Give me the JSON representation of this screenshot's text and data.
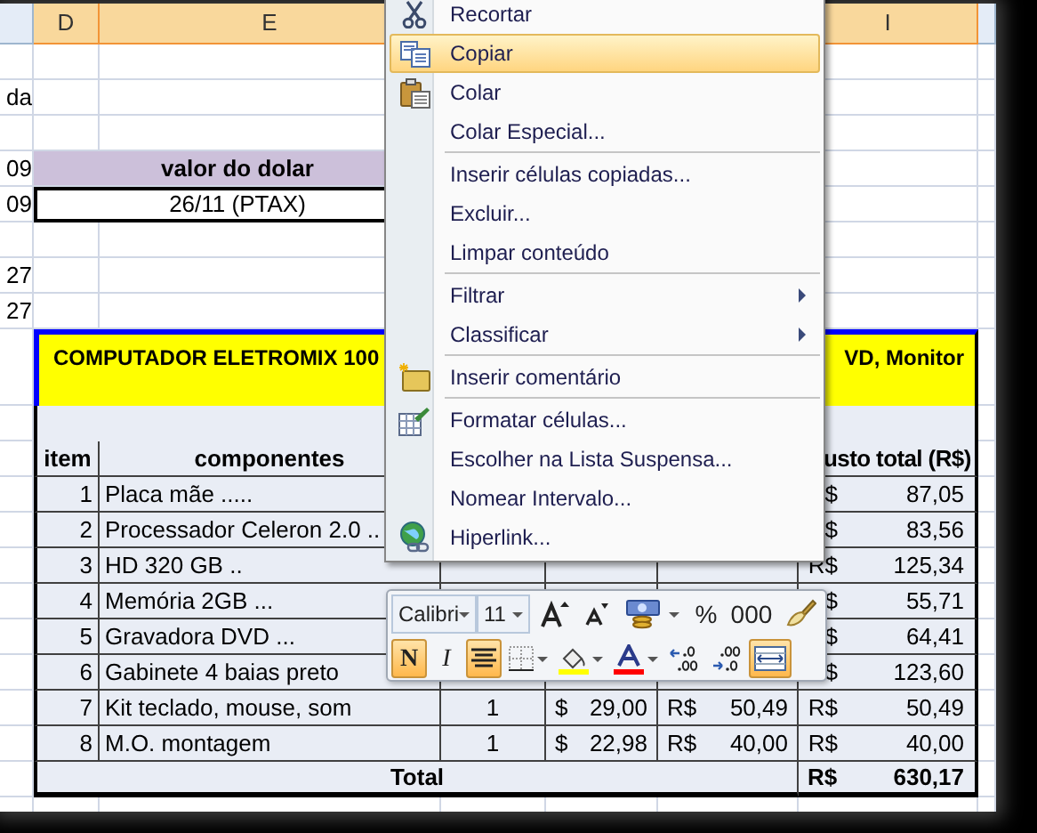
{
  "column_headers": [
    "D",
    "E",
    "I"
  ],
  "left_column_fragments": [
    "da",
    "09",
    "09",
    "27",
    "27"
  ],
  "dollar_box": {
    "heading": "valor do dolar",
    "value": "26/11 (PTAX)"
  },
  "product_table": {
    "title_parts": [
      "COMPUTADOR ELETROMIX 100",
      "VD, Monitor"
    ],
    "headers": [
      "item",
      "componentes",
      "usto total (R$)"
    ],
    "rows": [
      {
        "item": "1",
        "component": "Placa mãe .....",
        "total_currency": "$",
        "total": "87,05"
      },
      {
        "item": "2",
        "component": "Processador Celeron 2.0 ..",
        "total_currency": "$",
        "total": "83,56"
      },
      {
        "item": "3",
        "component": "HD 320 GB ..",
        "total_currency": "R$",
        "total": "125,34"
      },
      {
        "item": "4",
        "component": "Memória 2GB ...",
        "total_currency": "$",
        "total": "55,71"
      },
      {
        "item": "5",
        "component": "Gravadora DVD ...",
        "total_currency": "$",
        "total": "64,41"
      },
      {
        "item": "6",
        "component": "Gabinete 4 baias preto",
        "total_currency": "$",
        "total": "123,60"
      },
      {
        "item": "7",
        "component": "Kit teclado, mouse, som",
        "quantity": "1",
        "usd_sign": "$",
        "usd": "29,00",
        "brl_sign": "R$",
        "brl": "50,49",
        "total_currency": "R$",
        "total": "50,49"
      },
      {
        "item": "8",
        "component": "M.O. montagem",
        "quantity": "1",
        "usd_sign": "$",
        "usd": "22,98",
        "brl_sign": "R$",
        "brl": "40,00",
        "total_currency": "R$",
        "total": "40,00"
      }
    ],
    "total_label": "Total",
    "grand_total_currency": "R$",
    "grand_total": "630,17"
  },
  "context_menu": {
    "items": [
      {
        "kind": "item",
        "label": "Recortar",
        "selected": false
      },
      {
        "kind": "item",
        "label": "Copiar",
        "selected": true
      },
      {
        "kind": "item",
        "label": "Colar",
        "selected": false
      },
      {
        "kind": "item",
        "label": "Colar Especial...",
        "selected": false
      },
      {
        "kind": "separator"
      },
      {
        "kind": "item",
        "label": "Inserir células copiadas...",
        "selected": false
      },
      {
        "kind": "item",
        "label": "Excluir...",
        "selected": false
      },
      {
        "kind": "item",
        "label": "Limpar conteúdo",
        "selected": false
      },
      {
        "kind": "separator"
      },
      {
        "kind": "item",
        "label": "Filtrar",
        "submenu": true,
        "selected": false
      },
      {
        "kind": "item",
        "label": "Classificar",
        "submenu": true,
        "selected": false
      },
      {
        "kind": "separator"
      },
      {
        "kind": "item",
        "label": "Inserir comentário",
        "selected": false
      },
      {
        "kind": "separator"
      },
      {
        "kind": "item",
        "label": "Formatar células...",
        "selected": false
      },
      {
        "kind": "item",
        "label": "Escolher na Lista Suspensa...",
        "selected": false
      },
      {
        "kind": "item",
        "label": "Nomear Intervalo...",
        "selected": false
      },
      {
        "kind": "item",
        "label": "Hiperlink...",
        "selected": false
      }
    ]
  },
  "mini_toolbar": {
    "font": "Calibri",
    "size": "11",
    "row_1": [
      {
        "kind": "grow-font"
      },
      {
        "kind": "shrink-font"
      },
      {
        "kind": "accounting",
        "dropdown": true
      },
      {
        "kind": "text",
        "label": "%"
      },
      {
        "kind": "text",
        "label": "000"
      },
      {
        "kind": "painter"
      }
    ],
    "row_2": [
      {
        "kind": "bold",
        "label": "N",
        "on": true
      },
      {
        "kind": "italic",
        "label": "I",
        "on": false
      },
      {
        "kind": "center",
        "on": true
      },
      {
        "kind": "borders",
        "dropdown": true
      },
      {
        "kind": "fill",
        "color": "#ffff00",
        "dropdown": true
      },
      {
        "kind": "font-color",
        "color": "#ff0000",
        "dropdown": true
      },
      {
        "kind": "increase-decimal"
      },
      {
        "kind": "decrease-decimal"
      },
      {
        "kind": "merge",
        "on": true
      }
    ]
  }
}
